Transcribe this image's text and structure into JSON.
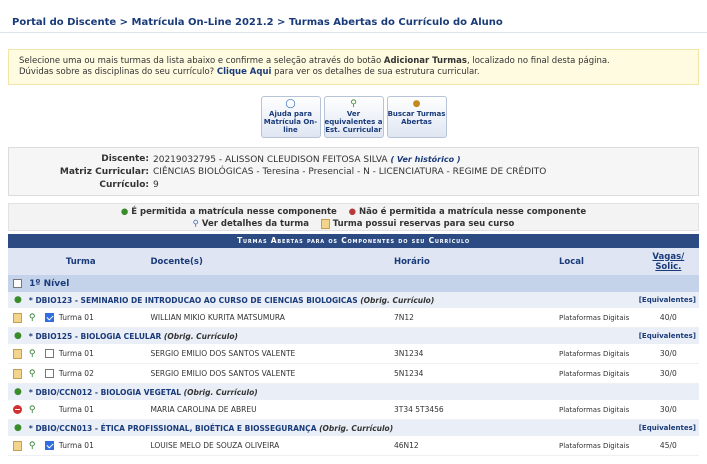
{
  "breadcrumb": "Portal do Discente > Matrícula On-Line 2021.2 > Turmas Abertas do Currículo do Aluno",
  "notice": {
    "line1_pre": "Selecione uma ou mais turmas da lista abaixo e confirme a seleção através do botão ",
    "line1_bold": "Adicionar Turmas",
    "line1_post": ", localizado no final desta página.",
    "line2_pre": "Dúvidas sobre as disciplinas do seu currículo? ",
    "line2_link": "Clique Aqui",
    "line2_post": " para ver os detalhes de sua estrutura curricular."
  },
  "buttons": [
    {
      "label": "Ajuda para Matrícula On-line"
    },
    {
      "label": "Ver equivalentes a Est. Curricular"
    },
    {
      "label": "Buscar Turmas Abertas"
    }
  ],
  "info": {
    "discente_label": "Discente:",
    "discente_value": "20219032795 - ALISSON CLEUDISON FEITOSA SILVA",
    "historico_link": "Ver histórico",
    "matriz_label": "Matriz Curricular:",
    "matriz_value": "CIÊNCIAS BIOLÓGICAS - Teresina - Presencial - N - LICENCIATURA - REGIME DE CRÉDITO",
    "curriculo_label": "Currículo:",
    "curriculo_value": "9"
  },
  "legend": {
    "allowed": "É permitida a matrícula nesse componente",
    "not_allowed": "Não é permitida a matrícula nesse componente",
    "details": "Ver detalhes da turma",
    "reserved": "Turma possui reservas para seu curso"
  },
  "table": {
    "caption": "Turmas Abertas para os Componentes do seu Currículo",
    "col_turma": "Turma",
    "col_docente": "Docente(s)",
    "col_horario": "Horário",
    "col_local": "Local",
    "col_vagas": "Vagas/ Solic.",
    "nivel": "1º Nível",
    "equivalentes": "[Equivalentes]",
    "components": [
      {
        "title": "* DBIO123 - SEMINARIO DE INTRODUCAO AO CURSO DE CIENCIAS BIOLOGICAS",
        "obrig": "(Obrig. Currículo)",
        "status": "allowed",
        "show_equiv": true,
        "turmas": [
          {
            "turma": "Turma 01",
            "docente": "WILLIAN MIKIO KURITA MATSUMURA",
            "horario": "7N12",
            "local": "Plataformas Digitais",
            "vagas": "40/0",
            "checked": true,
            "reserved": true
          }
        ]
      },
      {
        "title": "* DBIO125 - BIOLOGIA CELULAR",
        "obrig": "(Obrig. Currículo)",
        "status": "allowed",
        "show_equiv": true,
        "turmas": [
          {
            "turma": "Turma 01",
            "docente": "SERGIO EMILIO DOS SANTOS VALENTE",
            "horario": "3N1234",
            "local": "Plataformas Digitais",
            "vagas": "30/0",
            "checked": false,
            "reserved": true
          },
          {
            "turma": "Turma 02",
            "docente": "SERGIO EMILIO DOS SANTOS VALENTE",
            "horario": "5N1234",
            "local": "Plataformas Digitais",
            "vagas": "30/0",
            "checked": false,
            "reserved": true
          }
        ]
      },
      {
        "title": "* DBIO/CCN012 - BIOLOGIA VEGETAL",
        "obrig": "(Obrig. Currículo)",
        "status": "allowed",
        "show_equiv": false,
        "turmas": [
          {
            "turma": "Turma 01",
            "docente": "MARIA CAROLINA DE ABREU",
            "horario": "3T34 5T3456",
            "local": "Plataformas Digitais",
            "vagas": "30/0",
            "checked": false,
            "reserved": false,
            "blocked": true
          }
        ]
      },
      {
        "title": "* DBIO/CCN013 - ÉTICA PROFISSIONAL, BIOÉTICA E BIOSSEGURANÇA",
        "obrig": "(Obrig. Currículo)",
        "status": "allowed",
        "show_equiv": true,
        "turmas": [
          {
            "turma": "Turma 01",
            "docente": "LOUISE MELO DE SOUZA OLIVEIRA",
            "horario": "46N12",
            "local": "Plataformas Digitais",
            "vagas": "45/0",
            "checked": true,
            "reserved": true
          }
        ]
      }
    ]
  }
}
